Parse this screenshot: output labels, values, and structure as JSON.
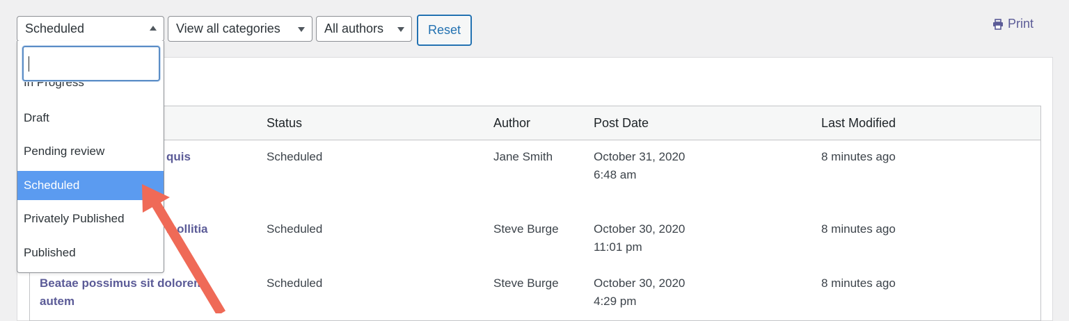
{
  "filters": {
    "status": {
      "selected": "Scheduled"
    },
    "category": {
      "selected": "View all categories"
    },
    "author": {
      "selected": "All authors"
    },
    "reset_label": "Reset"
  },
  "print_label": "Print",
  "dropdown": {
    "search_value": "",
    "options": [
      {
        "label": "In Progress"
      },
      {
        "label": "Draft"
      },
      {
        "label": "Pending review"
      },
      {
        "label": "Scheduled",
        "selected": true
      },
      {
        "label": "Privately Published"
      },
      {
        "label": "Published"
      }
    ]
  },
  "table": {
    "headers": [
      "Status",
      "Author",
      "Post Date",
      "Last Modified"
    ],
    "rows": [
      {
        "title": "quis",
        "title_line2": "",
        "status": "Scheduled",
        "author": "Jane Smith",
        "date": "October 31, 2020",
        "time": "6:48 am",
        "modified": "8 minutes ago"
      },
      {
        "title": "mollitia",
        "title_line2": "",
        "status": "Scheduled",
        "author": "Steve Burge",
        "date": "October 30, 2020",
        "time": "11:01 pm",
        "modified": "8 minutes ago"
      },
      {
        "title": "Beatae possimus sit dolorem",
        "title_line2": "autem",
        "status": "Scheduled",
        "author": "Steve Burge",
        "date": "October 30, 2020",
        "time": "4:29 pm",
        "modified": "8 minutes ago"
      }
    ]
  },
  "colors": {
    "accent": "#2271b1",
    "link": "#5b5b97",
    "selected_option": "#5b9bf0",
    "annotation_arrow": "#ef6a57"
  }
}
